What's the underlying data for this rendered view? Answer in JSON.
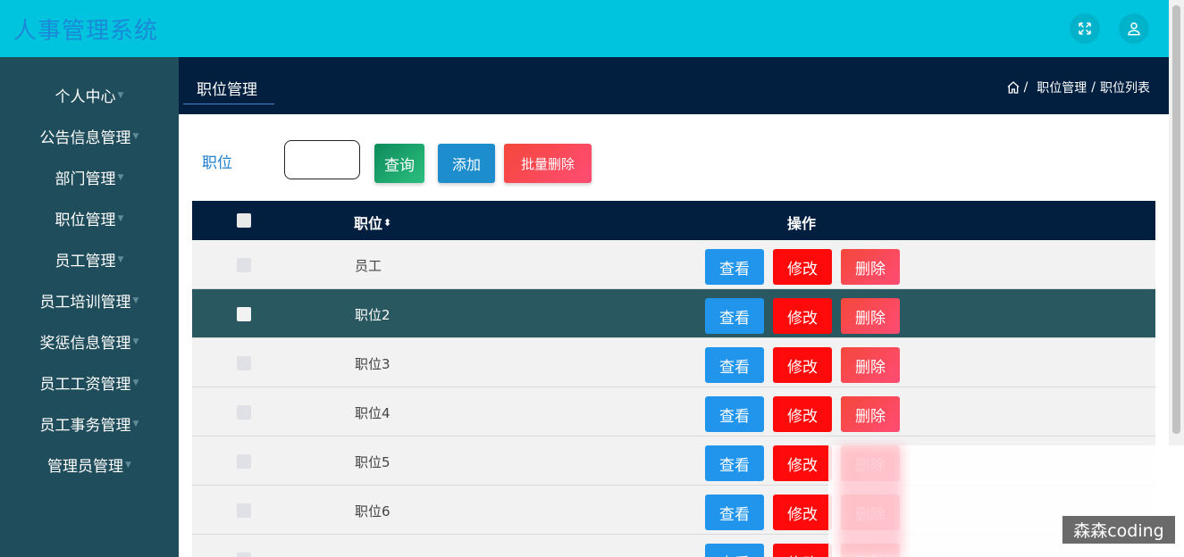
{
  "app": {
    "title": "人事管理系统"
  },
  "top_icons": {
    "fullscreen": "expand-arrows-icon",
    "user": "user-icon"
  },
  "sidebar": {
    "items": [
      {
        "label": "个人中心"
      },
      {
        "label": "公告信息管理"
      },
      {
        "label": "部门管理"
      },
      {
        "label": "职位管理"
      },
      {
        "label": "员工管理"
      },
      {
        "label": "员工培训管理"
      },
      {
        "label": "奖惩信息管理"
      },
      {
        "label": "员工工资管理"
      },
      {
        "label": "员工事务管理"
      },
      {
        "label": "管理员管理"
      }
    ]
  },
  "header": {
    "title": "职位管理",
    "breadcrumb": {
      "home_icon": "home-icon",
      "level1": "职位管理",
      "level2": "职位列表",
      "separator": "/"
    }
  },
  "search": {
    "label": "职位",
    "value": "",
    "query_label": "查询",
    "add_label": "添加",
    "batch_delete_label": "批量删除"
  },
  "table": {
    "columns": {
      "position": "职位",
      "sort_icon": "sort-icon",
      "actions": "操作"
    },
    "rows": [
      {
        "position": "员工",
        "selected": false
      },
      {
        "position": "职位2",
        "selected": true
      },
      {
        "position": "职位3",
        "selected": false
      },
      {
        "position": "职位4",
        "selected": false
      },
      {
        "position": "职位5",
        "selected": false
      },
      {
        "position": "职位6",
        "selected": false
      },
      {
        "position": "",
        "selected": false
      }
    ],
    "actions": {
      "view": "查看",
      "edit": "修改",
      "delete": "删除"
    }
  },
  "watermark": "森森coding",
  "colors": {
    "topbar": "#00c3dd",
    "sidebar": "#1f4d5b",
    "header": "#021f3f",
    "view_button": "#2195ec",
    "edit_button": "#ff0a0a",
    "delete_button": "#f4473b",
    "selected_row": "#2a5861"
  }
}
